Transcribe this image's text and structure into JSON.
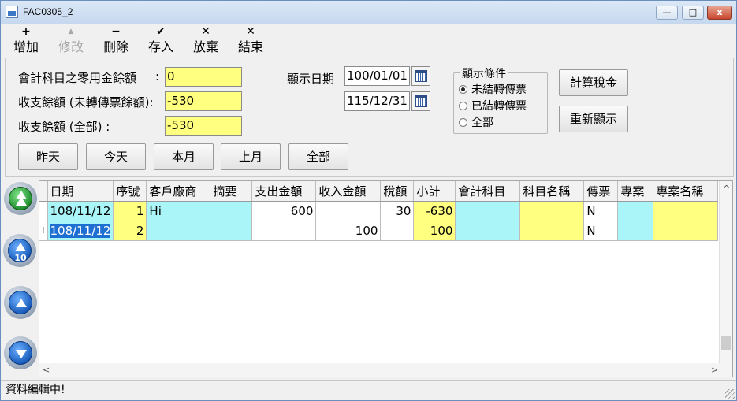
{
  "window": {
    "title": "FAC0305_2",
    "min_glyph": "—",
    "max_glyph": "□",
    "close_glyph": "x"
  },
  "toolbar": {
    "add": {
      "icon": "+",
      "label": "增加"
    },
    "edit": {
      "icon": "▲",
      "label": "修改"
    },
    "delete": {
      "icon": "−",
      "label": "刪除"
    },
    "save": {
      "icon": "✔",
      "label": "存入"
    },
    "discard": {
      "icon": "✕",
      "label": "放棄"
    },
    "exit": {
      "icon": "✕",
      "label": "結束"
    }
  },
  "form": {
    "petty_label": "會計科目之零用金餘額",
    "petty_colon": ":",
    "petty_value": "0",
    "balance_unposted_label": "收支餘額 (未轉傳票餘額):",
    "balance_unposted_value": "-530",
    "balance_all_label": "收支餘額 (全部) :",
    "balance_all_value": "-530",
    "date_label": "顯示日期",
    "date_from": "100/01/01",
    "date_to": "115/12/31"
  },
  "filter": {
    "title": "顯示條件",
    "options": [
      "未結轉傳票",
      "已結轉傳票",
      "全部"
    ],
    "selected": "未結轉傳票"
  },
  "buttons": {
    "calc_tax": "計算稅金",
    "refresh": "重新顯示",
    "yesterday": "昨天",
    "today": "今天",
    "this_month": "本月",
    "last_month": "上月",
    "all": "全部"
  },
  "nav": {
    "page_step": "10"
  },
  "grid": {
    "columns": [
      "日期",
      "序號",
      "客戶廠商",
      "摘要",
      "支出金額",
      "收入金額",
      "稅額",
      "小計",
      "會計科目",
      "科目名稱",
      "傳票",
      "專案",
      "專案名稱"
    ],
    "rows": [
      {
        "indicator": "",
        "date": "108/11/12",
        "seq": "1",
        "vendor": "Hi",
        "summary": "",
        "expense": "600",
        "income": "",
        "tax": "30",
        "subtotal": "-630",
        "account": "",
        "account_name": "",
        "voucher": "N",
        "project": "",
        "project_name": ""
      },
      {
        "indicator": "I",
        "date": "108/11/12",
        "seq": "2",
        "vendor": "",
        "summary": "",
        "expense": "",
        "income": "100",
        "tax": "",
        "subtotal": "100",
        "account": "",
        "account_name": "",
        "voucher": "N",
        "project": "",
        "project_name": ""
      }
    ],
    "scroll_left": "<",
    "scroll_right": ">",
    "scroll_up": "^"
  },
  "status": {
    "text": "資料編輯中!"
  },
  "colors": {
    "cyan_cell": "#a9f5f7",
    "yellow_cell": "#ffff80",
    "selection": "#1e6fd2"
  }
}
